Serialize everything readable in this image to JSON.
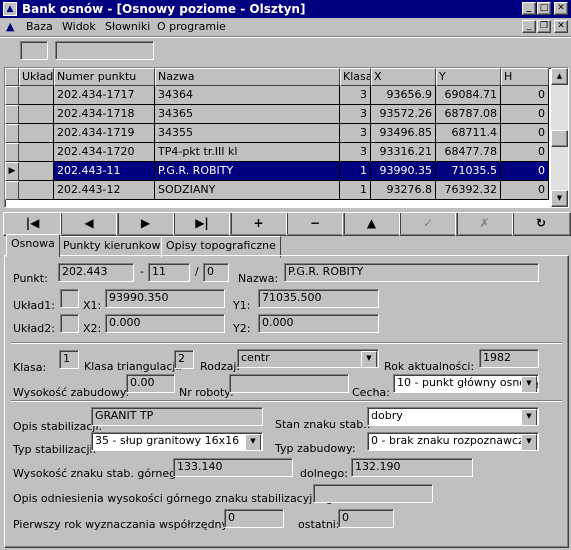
{
  "window": {
    "title": "Bank osnów - [Osnowy poziome - Olsztyn]"
  },
  "menu": [
    "Baza",
    "Widok",
    "Słowniki",
    "O programie"
  ],
  "grid": {
    "columns": [
      "Układ",
      "Numer punktu",
      "Nazwa",
      "Klasa",
      "X",
      "Y",
      "H"
    ],
    "rows": [
      [
        "",
        "202.434-1717",
        "34364",
        "3",
        "93656.9",
        "69084.71",
        "0"
      ],
      [
        "",
        "202.434-1718",
        "34365",
        "3",
        "93572.26",
        "68787.08",
        "0"
      ],
      [
        "",
        "202.434-1719",
        "34355",
        "3",
        "93496.85",
        "68711.4",
        "0"
      ],
      [
        "",
        "202.434-1720",
        "TP4-pkt tr.III kl",
        "3",
        "93316.21",
        "68477.78",
        "0"
      ],
      [
        "",
        "202.443-11",
        "P.G.R. ROBITY",
        "1",
        "93990.35",
        "71035.5",
        "0"
      ],
      [
        "",
        "202.443-12",
        "SODZIANY",
        "1",
        "93276.8",
        "76392.32",
        "0"
      ]
    ],
    "selected_row": 4
  },
  "navigator": [
    "|◀",
    "◀",
    "▶",
    "▶|",
    "+",
    "−",
    "▲",
    "✓",
    "✗",
    "↻"
  ],
  "tabs": [
    "Osnowa",
    "Punkty kierunkowe",
    "Opisy topograficzne"
  ],
  "form": {
    "punkt_label": "Punkt:",
    "punkt_a": "202.443",
    "punkt_b": "11",
    "punkt_c": "0",
    "sep_dash": "-",
    "sep_slash": "/",
    "nazwa_label": "Nazwa:",
    "nazwa": "P.G.R. ROBITY",
    "uklad1_label": "Układ1:",
    "x1_label": "X1:",
    "x1": "93990.350",
    "y1_label": "Y1:",
    "y1": "71035.500",
    "uklad2_label": "Układ2:",
    "x2_label": "X2:",
    "x2": "0.000",
    "y2_label": "Y2:",
    "y2": "0.000",
    "klasa_label": "Klasa:",
    "klasa": "1",
    "klasa_tri_label": "Klasa triangulacji:",
    "klasa_tri": "2",
    "rodzaj_label": "Rodzaj:",
    "rodzaj": "centr",
    "rok_label": "Rok aktualności:",
    "rok": "1982",
    "wys_zab_label": "Wysokość zabudowy:",
    "wys_zab": "0.00",
    "nr_roboty_label": "Nr roboty:",
    "nr_roboty": "",
    "cecha_label": "Cecha:",
    "cecha": "10 - punkt główny osnowy",
    "opis_stab_label": "Opis stabilizacji:",
    "opis_stab": "GRANIT TP",
    "stan_label": "Stan znaku stab.:",
    "stan": "dobry",
    "typ_stab_label": "Typ stabilizacji:",
    "typ_stab": "35 - słup granitowy 16x16",
    "typ_zab_label": "Typ zabudowy:",
    "typ_zab": "0 - brak znaku rozpoznawczego",
    "wys_gorny_label": "Wysokość znaku stab. górnego:",
    "wys_gorny": "133.140",
    "dolnego_label": "dolnego:",
    "dolnego": "132.190",
    "opis_odn_label": "Opis odniesienia wysokości górnego znaku stabilizacyjnego:",
    "opis_odn": "",
    "pierwszy_label": "Pierwszy rok wyznaczania  współrzędnych:",
    "pierwszy": "0",
    "ostatni_label": "ostatni:",
    "ostatni": "0"
  }
}
